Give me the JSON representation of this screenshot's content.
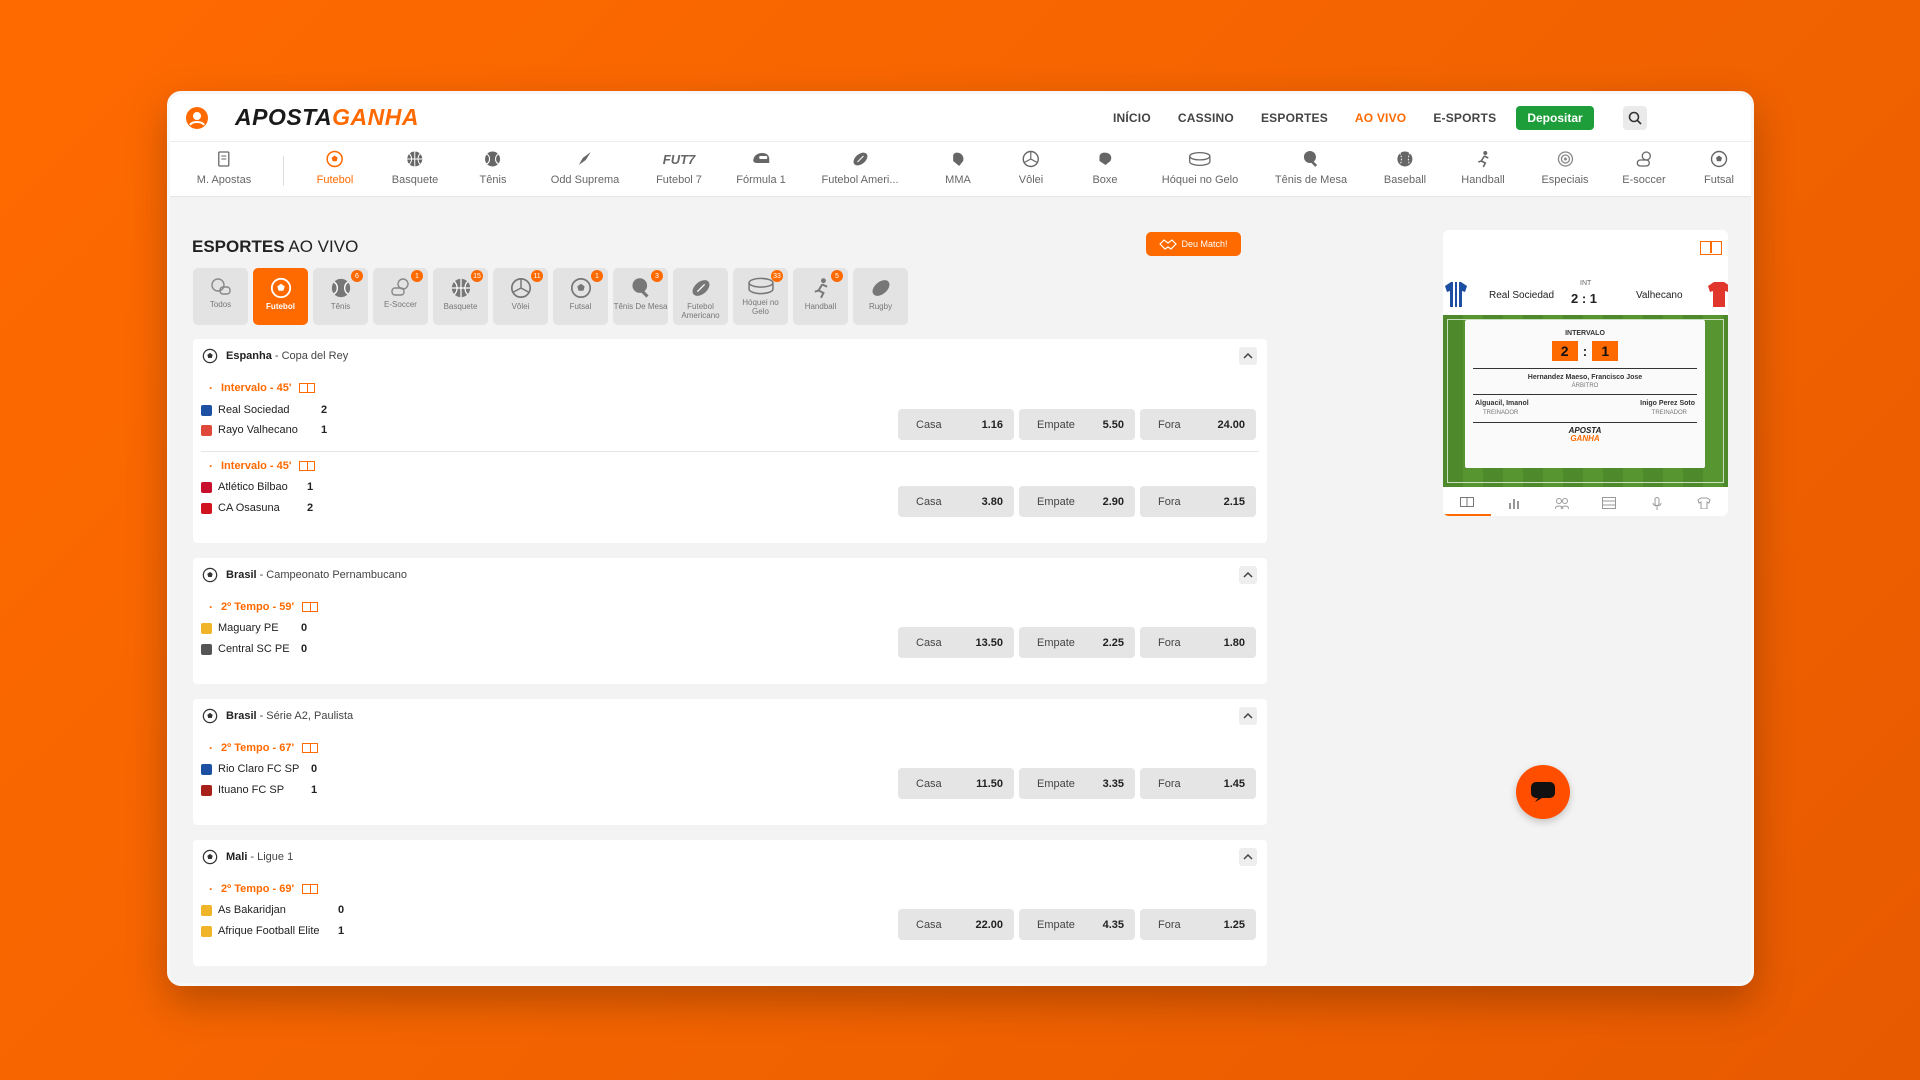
{
  "brand": {
    "name_part1": "APOSTA",
    "name_part2": "GANHA",
    "accent": "#ff6a00",
    "deposit_color": "#1e9e3a"
  },
  "topnav": [
    "INÍCIO",
    "CASSINO",
    "ESPORTES",
    "AO VIVO",
    "E-SPORTS"
  ],
  "active_topnav": "AO VIVO",
  "deposit_label": "Depositar",
  "sports_bar": [
    {
      "label": "M. Apostas",
      "icon": "receipt-icon"
    },
    {
      "label": "Futebol",
      "icon": "soccer-icon"
    },
    {
      "label": "Basquete",
      "icon": "basketball-icon"
    },
    {
      "label": "Tênis",
      "icon": "tennis-icon"
    },
    {
      "label": "Odd Suprema",
      "icon": "rocket-icon"
    },
    {
      "label": "Futebol 7",
      "icon": "fut7-icon"
    },
    {
      "label": "Fórmula 1",
      "icon": "helmet-icon"
    },
    {
      "label": "Futebol Ameri...",
      "icon": "american-football-icon"
    },
    {
      "label": "MMA",
      "icon": "glove-icon"
    },
    {
      "label": "Vôlei",
      "icon": "volleyball-icon"
    },
    {
      "label": "Boxe",
      "icon": "boxing-icon"
    },
    {
      "label": "Hóquei no Gelo",
      "icon": "puck-icon"
    },
    {
      "label": "Tênis de Mesa",
      "icon": "table-tennis-icon"
    },
    {
      "label": "Baseball",
      "icon": "baseball-icon"
    },
    {
      "label": "Handball",
      "icon": "handball-icon"
    },
    {
      "label": "Especiais",
      "icon": "target-icon"
    },
    {
      "label": "E-soccer",
      "icon": "gamepad-icon"
    },
    {
      "label": "Futsal",
      "icon": "futsal-icon"
    }
  ],
  "page_title": {
    "bold": "ESPORTES",
    "rest": "AO VIVO"
  },
  "match_button": "Deu Match!",
  "filters": [
    {
      "label": "Todos",
      "badge": ""
    },
    {
      "label": "Futebol",
      "badge": ""
    },
    {
      "label": "Tênis",
      "badge": "6"
    },
    {
      "label": "E-Soccer",
      "badge": "1"
    },
    {
      "label": "Basquete",
      "badge": "15"
    },
    {
      "label": "Vôlei",
      "badge": "11"
    },
    {
      "label": "Futsal",
      "badge": "1"
    },
    {
      "label": "Tênis De Mesa",
      "badge": "3"
    },
    {
      "label": "Futebol Americano",
      "badge": ""
    },
    {
      "label": "Hóquei no Gelo",
      "badge": "33"
    },
    {
      "label": "Handball",
      "badge": "5"
    },
    {
      "label": "Rugby",
      "badge": ""
    }
  ],
  "leagues": [
    {
      "country": "Espanha",
      "name": "- Copa del Rey",
      "games": [
        {
          "status": "Intervalo - 45'",
          "home": "Real Sociedad",
          "home_score": "2",
          "away": "Rayo Valhecano",
          "away_score": "1",
          "odds": [
            {
              "label": "Casa",
              "value": "1.16"
            },
            {
              "label": "Empate",
              "value": "5.50"
            },
            {
              "label": "Fora",
              "value": "24.00"
            }
          ]
        },
        {
          "status": "Intervalo - 45'",
          "home": "Atlético Bilbao",
          "home_score": "1",
          "away": "CA Osasuna",
          "away_score": "2",
          "odds": [
            {
              "label": "Casa",
              "value": "3.80"
            },
            {
              "label": "Empate",
              "value": "2.90"
            },
            {
              "label": "Fora",
              "value": "2.15"
            }
          ]
        }
      ]
    },
    {
      "country": "Brasil",
      "name": "- Campeonato Pernambucano",
      "games": [
        {
          "status": "2º Tempo - 59'",
          "home": "Maguary PE",
          "home_score": "0",
          "away": "Central SC PE",
          "away_score": "0",
          "odds": [
            {
              "label": "Casa",
              "value": "13.50"
            },
            {
              "label": "Empate",
              "value": "2.25"
            },
            {
              "label": "Fora",
              "value": "1.80"
            }
          ]
        }
      ]
    },
    {
      "country": "Brasil",
      "name": "- Série A2, Paulista",
      "games": [
        {
          "status": "2º Tempo - 67'",
          "home": "Rio Claro FC SP",
          "home_score": "0",
          "away": "Ituano FC SP",
          "away_score": "1",
          "odds": [
            {
              "label": "Casa",
              "value": "11.50"
            },
            {
              "label": "Empate",
              "value": "3.35"
            },
            {
              "label": "Fora",
              "value": "1.45"
            }
          ]
        }
      ]
    },
    {
      "country": "Mali",
      "name": "- Ligue 1",
      "games": [
        {
          "status": "2º Tempo - 69'",
          "home": "As Bakaridjan",
          "home_score": "0",
          "away": "Afrique Football Elite",
          "away_score": "1",
          "odds": [
            {
              "label": "Casa",
              "value": "22.00"
            },
            {
              "label": "Empate",
              "value": "4.35"
            },
            {
              "label": "Fora",
              "value": "1.25"
            }
          ]
        }
      ]
    }
  ],
  "widget": {
    "home": "Real Sociedad",
    "away": "Valhecano",
    "period_short": "INT",
    "score": "2 : 1",
    "period": "INTERVALO",
    "home_score": "2",
    "away_score": "1",
    "referee": "Hernandez Maeso, Francisco Jose",
    "referee_label": "ÁRBITRO",
    "home_coach": "Alguacil, Imanol",
    "away_coach": "Inigo Perez Soto",
    "coach_label": "TREINADOR",
    "logo1": "APOSTA",
    "logo2": "GANHA"
  }
}
